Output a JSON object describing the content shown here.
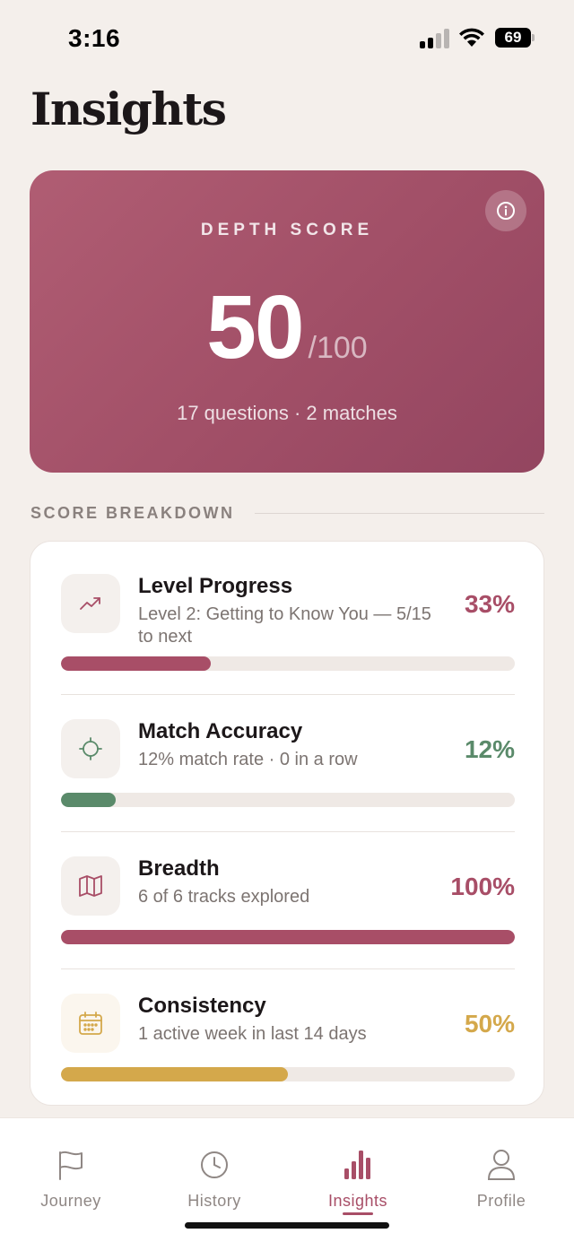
{
  "status_bar": {
    "time": "3:16",
    "battery": "69"
  },
  "page": {
    "title": "Insights"
  },
  "depth_score": {
    "label": "DEPTH SCORE",
    "value": "50",
    "max": "/100",
    "summary": "17 questions · 2 matches",
    "info_icon": "info-icon"
  },
  "breakdown": {
    "header": "SCORE BREAKDOWN",
    "items": [
      {
        "title": "Level Progress",
        "subtitle": "Level 2: Getting to Know You — 5/15 to next",
        "percent_label": "33%",
        "progress": 0.33,
        "color": "#a84e67",
        "icon": "trending-up-icon"
      },
      {
        "title": "Match Accuracy",
        "subtitle": "12% match rate · 0 in a row",
        "percent_label": "12%",
        "progress": 0.12,
        "color": "#5a8a6a",
        "icon": "crosshair-icon"
      },
      {
        "title": "Breadth",
        "subtitle": "6 of 6 tracks explored",
        "percent_label": "100%",
        "progress": 1.0,
        "color": "#a84e67",
        "icon": "map-icon"
      },
      {
        "title": "Consistency",
        "subtitle": "1 active week in last 14 days",
        "percent_label": "50%",
        "progress": 0.5,
        "color": "#d4a84b",
        "icon": "calendar-icon"
      }
    ]
  },
  "tabs": [
    {
      "label": "Journey",
      "icon": "flag-icon",
      "active": false
    },
    {
      "label": "History",
      "icon": "clock-icon",
      "active": false
    },
    {
      "label": "Insights",
      "icon": "bar-chart-icon",
      "active": true
    },
    {
      "label": "Profile",
      "icon": "person-icon",
      "active": false
    }
  ],
  "colors": {
    "accent": "#a84e67",
    "green": "#5a8a6a",
    "gold": "#d4a84b",
    "background": "#f4efeb"
  }
}
